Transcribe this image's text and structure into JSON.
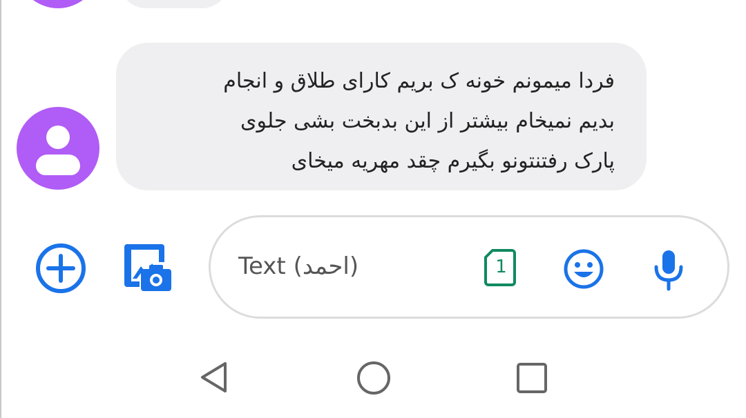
{
  "conversation": {
    "message": {
      "lines": [
        "فردا میمونم خونه ک بریم کارای طلاق و انجام",
        "بدیم نمیخام بیشتر از این بدبخت بشی جلوی",
        "پارک رفتنتونو بگیرم چقد مهریه میخای"
      ],
      "avatar_icon": "person-icon",
      "avatar_color": "#b05cf6",
      "bubble_color": "#efeff1"
    }
  },
  "composer": {
    "placeholder": "Text (احمد)",
    "value": "",
    "sim_number": "1",
    "icons": {
      "add": "add-circle-icon",
      "gallery": "gallery-camera-icon",
      "sim": "sim-card-icon",
      "emoji": "emoji-icon",
      "mic": "microphone-icon"
    },
    "accent_color": "#1a73e8",
    "sim_color": "#0f8a5f"
  },
  "navbar": {
    "icons": {
      "back": "back-triangle-icon",
      "home": "home-circle-icon",
      "recents": "recents-square-icon"
    }
  }
}
